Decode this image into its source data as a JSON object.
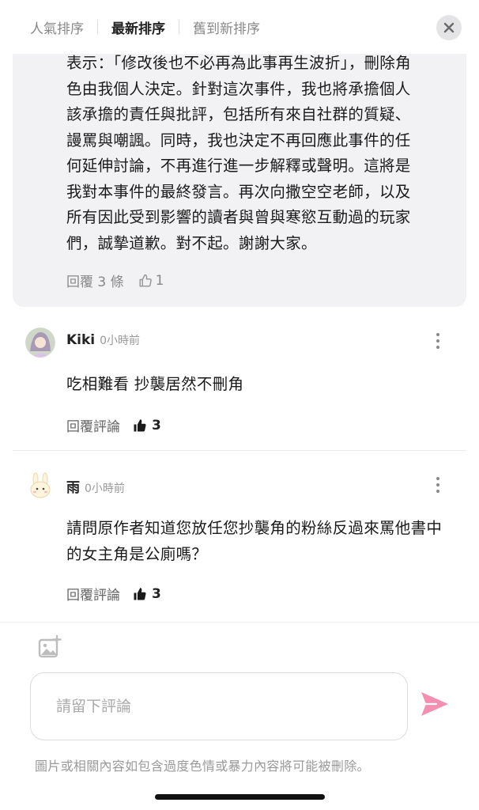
{
  "sort_tabs": [
    {
      "label": "人氣排序",
      "active": false
    },
    {
      "label": "最新排序",
      "active": true
    },
    {
      "label": "舊到新排序",
      "active": false
    }
  ],
  "reply": {
    "lines": [
      "表示：「修改後也不必再為此事再生波折」，刪除角",
      "色由我個人決定。針對這次事件，我也將承擔個人",
      "該承擔的責任與批評，包括所有來自社群的質疑、",
      "謾罵與嘲諷。同時，我也決定不再回應此事件的任",
      "何延伸討論，不再進行進一步解釋或聲明。這將是",
      "我對本事件的最終發言。再次向撒空空老師，以及",
      "所有因此受到影響的讀者與曾與寒慾互動過的玩家",
      "們，誠摯道歉。對不起。謝謝大家。"
    ],
    "replies_label": "回覆 3 條",
    "likes": "1"
  },
  "comments": [
    {
      "author": "Kiki",
      "time": "0小時前",
      "text": "吃相難看 抄襲居然不刪角",
      "reply_label": "回覆評論",
      "likes": "3"
    },
    {
      "author": "雨",
      "time": "0小時前",
      "text": "請問原作者知道您放任您抄襲角的粉絲反過來罵他書中的女主角是公廁嗎？",
      "reply_label": "回覆評論",
      "likes": "3"
    }
  ],
  "composer": {
    "placeholder": "請留下評論",
    "notice": "圖片或相關內容如包含過度色情或暴力內容將可能被刪除。"
  },
  "colors": {
    "accent_send": "#f48fb1",
    "card_bg": "#f2f2f4"
  },
  "icons": {
    "close": "close-icon",
    "like_outline": "thumbs-up-outline-icon",
    "like_filled": "thumbs-up-filled-icon",
    "image": "image-add-icon",
    "send": "send-icon",
    "more": "kebab-menu-icon"
  }
}
